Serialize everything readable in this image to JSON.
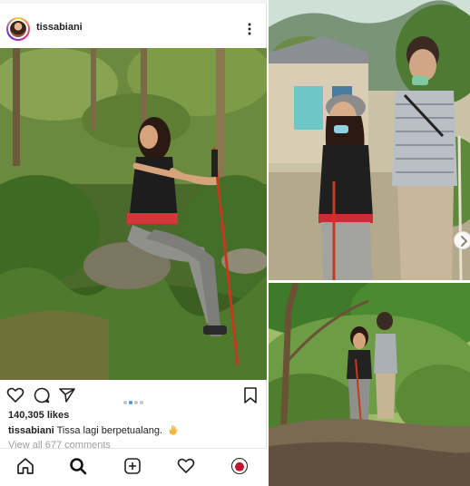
{
  "post": {
    "username": "tissabiani",
    "likes": "140,305 likes",
    "caption_user": "tissabiani",
    "caption_text": "Tissa lagi berpetualang.",
    "view_comments": "View all 677 comments"
  },
  "icons": {
    "more": "more-options-icon",
    "like": "heart-icon",
    "comment": "comment-icon",
    "share": "paper-plane-icon",
    "save": "bookmark-icon",
    "nav": [
      "home-icon",
      "search-icon",
      "add-post-icon",
      "activity-heart-icon",
      "profile-avatar"
    ]
  },
  "colors": {
    "carousel_active_dot": "#3897f0",
    "carousel_dot": "#c5c5c5",
    "text": "#222222",
    "muted_text": "#a0a0a0"
  },
  "carousel": {
    "total": 5,
    "active": 2
  }
}
